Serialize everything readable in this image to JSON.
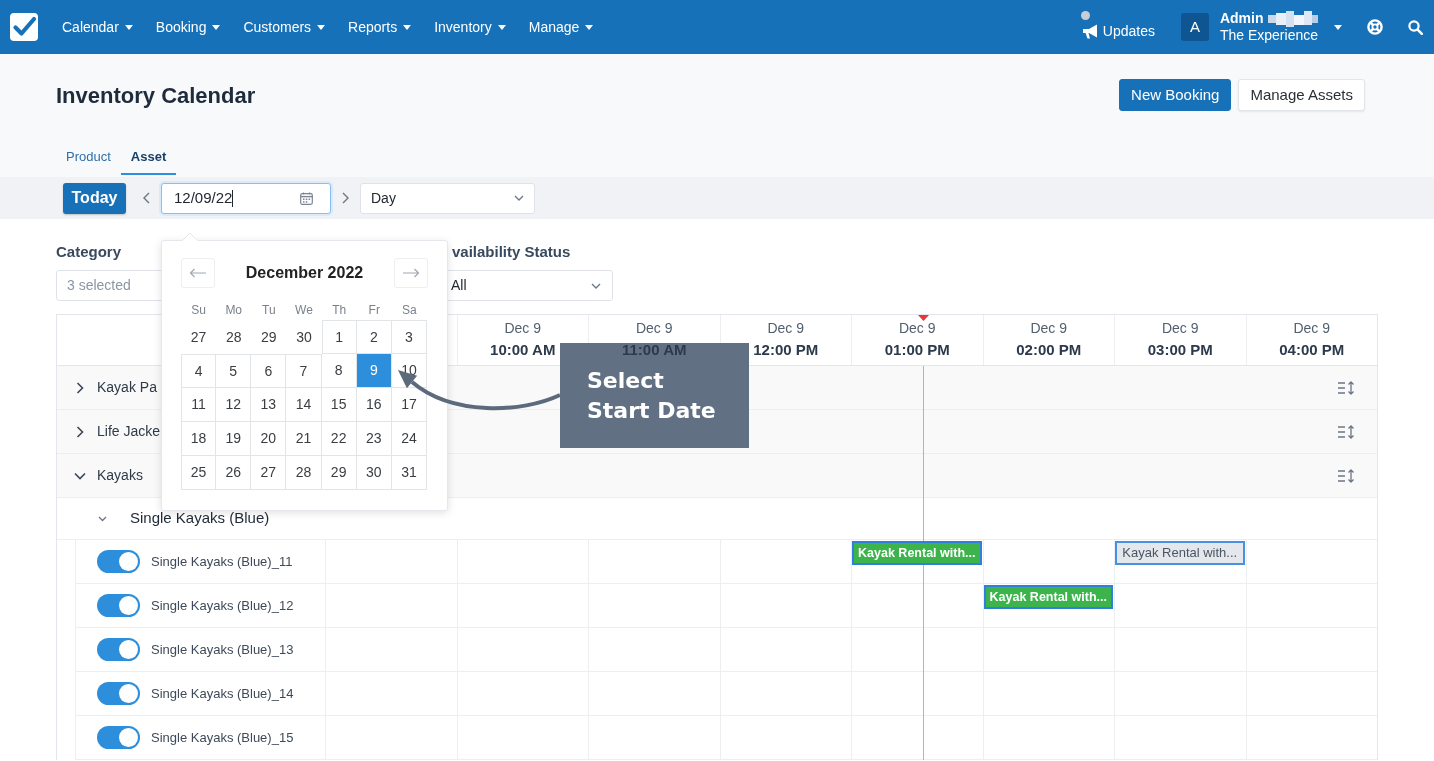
{
  "nav": {
    "menu": [
      {
        "label": "Calendar"
      },
      {
        "label": "Booking"
      },
      {
        "label": "Customers"
      },
      {
        "label": "Reports"
      },
      {
        "label": "Inventory"
      },
      {
        "label": "Manage"
      }
    ],
    "updates": {
      "label": "Updates",
      "unread": true
    },
    "account": {
      "initial": "A",
      "name": "Admin",
      "organization": "The Experience"
    }
  },
  "page": {
    "title": "Inventory Calendar",
    "actions": [
      {
        "label": "New Booking",
        "kind": "primary"
      },
      {
        "label": "Manage Assets",
        "kind": "secondary"
      }
    ]
  },
  "tabs": [
    {
      "label": "Product",
      "selected": false
    },
    {
      "label": "Asset",
      "selected": true
    }
  ],
  "toolbar": {
    "today": "Today",
    "date": {
      "value": "12/09/22",
      "focused": true
    },
    "view": {
      "value": "Day"
    }
  },
  "filters": [
    {
      "label": "Category",
      "kind": "multiselect",
      "placeholder": "3 selected"
    },
    {
      "label": "vailability Status",
      "kind": "select",
      "value": "All"
    }
  ],
  "datepicker": {
    "month": "December 2022",
    "weekdays": [
      "Su",
      "Mo",
      "Tu",
      "We",
      "Th",
      "Fr",
      "Sa"
    ],
    "weeks": [
      [
        {
          "day": "27",
          "outside": true,
          "selected": false
        },
        {
          "day": "28",
          "outside": true,
          "selected": false
        },
        {
          "day": "29",
          "outside": true,
          "selected": false
        },
        {
          "day": "30",
          "outside": true,
          "selected": false
        },
        {
          "day": "1",
          "outside": false,
          "selected": false
        },
        {
          "day": "2",
          "outside": false,
          "selected": false
        },
        {
          "day": "3",
          "outside": false,
          "selected": false
        }
      ],
      [
        {
          "day": "4",
          "outside": false,
          "selected": false
        },
        {
          "day": "5",
          "outside": false,
          "selected": false
        },
        {
          "day": "6",
          "outside": false,
          "selected": false
        },
        {
          "day": "7",
          "outside": false,
          "selected": false
        },
        {
          "day": "8",
          "outside": false,
          "selected": false
        },
        {
          "day": "9",
          "outside": false,
          "selected": true
        },
        {
          "day": "10",
          "outside": false,
          "selected": false
        }
      ],
      [
        {
          "day": "11",
          "outside": false,
          "selected": false
        },
        {
          "day": "12",
          "outside": false,
          "selected": false
        },
        {
          "day": "13",
          "outside": false,
          "selected": false
        },
        {
          "day": "14",
          "outside": false,
          "selected": false
        },
        {
          "day": "15",
          "outside": false,
          "selected": false
        },
        {
          "day": "16",
          "outside": false,
          "selected": false
        },
        {
          "day": "17",
          "outside": false,
          "selected": false
        }
      ],
      [
        {
          "day": "18",
          "outside": false,
          "selected": false
        },
        {
          "day": "19",
          "outside": false,
          "selected": false
        },
        {
          "day": "20",
          "outside": false,
          "selected": false
        },
        {
          "day": "21",
          "outside": false,
          "selected": false
        },
        {
          "day": "22",
          "outside": false,
          "selected": false
        },
        {
          "day": "23",
          "outside": false,
          "selected": false
        },
        {
          "day": "24",
          "outside": false,
          "selected": false
        }
      ],
      [
        {
          "day": "25",
          "outside": false,
          "selected": false
        },
        {
          "day": "26",
          "outside": false,
          "selected": false
        },
        {
          "day": "27",
          "outside": false,
          "selected": false
        },
        {
          "day": "28",
          "outside": false,
          "selected": false
        },
        {
          "day": "29",
          "outside": false,
          "selected": false
        },
        {
          "day": "30",
          "outside": false,
          "selected": false
        },
        {
          "day": "31",
          "outside": false,
          "selected": false
        }
      ]
    ]
  },
  "callout": {
    "text": "Select\nStart Date"
  },
  "timeline": {
    "columns": [
      {
        "date": "Dec 9",
        "time": "10:00 AM"
      },
      {
        "date": "Dec 9",
        "time": "11:00 AM"
      },
      {
        "date": "Dec 9",
        "time": "12:00 PM"
      },
      {
        "date": "Dec 9",
        "time": "01:00 PM"
      },
      {
        "date": "Dec 9",
        "time": "02:00 PM"
      },
      {
        "date": "Dec 9",
        "time": "03:00 PM"
      },
      {
        "date": "Dec 9",
        "time": "04:00 PM"
      }
    ],
    "groups": [
      {
        "kind": "group",
        "label": "Kayak Pa",
        "expanded": false
      },
      {
        "kind": "group",
        "label": "Life Jacke",
        "expanded": false
      },
      {
        "kind": "group",
        "label": "Kayaks",
        "expanded": true,
        "children": [
          {
            "kind": "subgroup",
            "label": "Single Kayaks (Blue)",
            "expanded": true,
            "children": [
              {
                "kind": "asset",
                "name": "Single Kayaks (Blue)_11",
                "on": true,
                "cells": [
                  null,
                  null,
                  null,
                  {
                    "label": "Kayak Rental with...",
                    "kind": "confirmed"
                  },
                  null,
                  {
                    "label": "Kayak Rental with...",
                    "kind": "pending"
                  },
                  null
                ]
              },
              {
                "kind": "asset",
                "name": "Single Kayaks (Blue)_12",
                "on": true,
                "cells": [
                  null,
                  null,
                  null,
                  null,
                  {
                    "label": "Kayak Rental with...",
                    "kind": "confirmed"
                  },
                  null,
                  null
                ]
              },
              {
                "kind": "asset",
                "name": "Single Kayaks (Blue)_13",
                "on": true,
                "cells": [
                  null,
                  null,
                  null,
                  null,
                  null,
                  null,
                  null
                ]
              },
              {
                "kind": "asset",
                "name": "Single Kayaks (Blue)_14",
                "on": true,
                "cells": [
                  null,
                  null,
                  null,
                  null,
                  null,
                  null,
                  null
                ]
              },
              {
                "kind": "asset",
                "name": "Single Kayaks (Blue)_15",
                "on": true,
                "cells": [
                  null,
                  null,
                  null,
                  null,
                  null,
                  null,
                  null
                ]
              }
            ]
          }
        ]
      }
    ]
  }
}
